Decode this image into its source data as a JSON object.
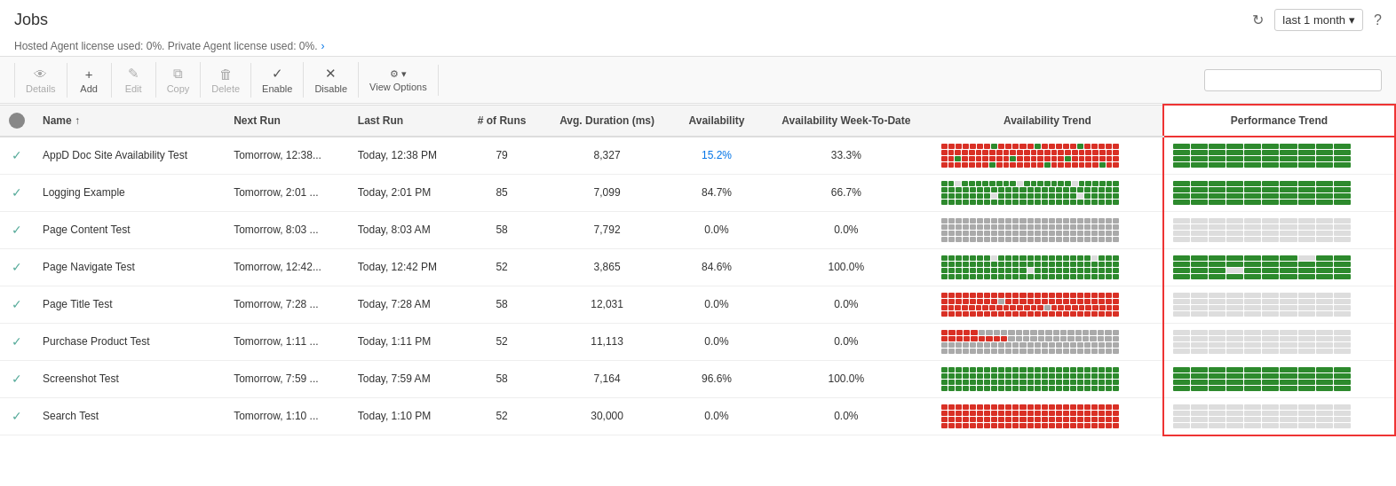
{
  "header": {
    "title": "Jobs",
    "time_filter": "last 1 month",
    "license_text": "Hosted Agent license used: 0%. Private Agent license used: 0%.",
    "license_link": "›"
  },
  "toolbar": {
    "details_label": "Details",
    "add_label": "Add",
    "edit_label": "Edit",
    "copy_label": "Copy",
    "delete_label": "Delete",
    "enable_label": "Enable",
    "disable_label": "Disable",
    "view_options_label": "View Options",
    "search_placeholder": ""
  },
  "columns": [
    {
      "key": "check",
      "label": ""
    },
    {
      "key": "name",
      "label": "Name ↑"
    },
    {
      "key": "next_run",
      "label": "Next Run"
    },
    {
      "key": "last_run",
      "label": "Last Run"
    },
    {
      "key": "runs",
      "label": "# of Runs"
    },
    {
      "key": "avg_duration",
      "label": "Avg. Duration (ms)"
    },
    {
      "key": "availability",
      "label": "Availability"
    },
    {
      "key": "availability_week",
      "label": "Availability Week-To-Date"
    },
    {
      "key": "availability_trend",
      "label": "Availability Trend"
    },
    {
      "key": "performance_trend",
      "label": "Performance Trend"
    }
  ],
  "rows": [
    {
      "name": "AppD Doc Site Availability Test",
      "next_run": "Tomorrow, 12:38...",
      "last_run": "Today, 12:38 PM",
      "runs": "79",
      "avg_duration": "8,327",
      "availability": "15.2%",
      "availability_highlight": true,
      "availability_week": "33.3%",
      "avail_trend": "mixed_bad",
      "perf_trend": "mostly_green"
    },
    {
      "name": "Logging Example",
      "next_run": "Tomorrow, 2:01 ...",
      "last_run": "Today, 2:01 PM",
      "runs": "85",
      "avg_duration": "7,099",
      "availability": "84.7%",
      "availability_highlight": false,
      "availability_week": "66.7%",
      "avail_trend": "mostly_green",
      "perf_trend": "all_green"
    },
    {
      "name": "Page Content Test",
      "next_run": "Tomorrow, 8:03 ...",
      "last_run": "Today, 8:03 AM",
      "runs": "58",
      "avg_duration": "7,792",
      "availability": "0.0%",
      "availability_highlight": false,
      "availability_week": "0.0%",
      "avail_trend": "all_gray",
      "perf_trend": "all_light"
    },
    {
      "name": "Page Navigate Test",
      "next_run": "Tomorrow, 12:42...",
      "last_run": "Today, 12:42 PM",
      "runs": "52",
      "avg_duration": "3,865",
      "availability": "84.6%",
      "availability_highlight": false,
      "availability_week": "100.0%",
      "avail_trend": "mostly_green2",
      "perf_trend": "green_gray"
    },
    {
      "name": "Page Title Test",
      "next_run": "Tomorrow, 7:28 ...",
      "last_run": "Today, 7:28 AM",
      "runs": "58",
      "avg_duration": "12,031",
      "availability": "0.0%",
      "availability_highlight": false,
      "availability_week": "0.0%",
      "avail_trend": "mostly_red",
      "perf_trend": "all_light2"
    },
    {
      "name": "Purchase Product Test",
      "next_run": "Tomorrow, 1:11 ...",
      "last_run": "Today, 1:11 PM",
      "runs": "52",
      "avg_duration": "11,113",
      "availability": "0.0%",
      "availability_highlight": false,
      "availability_week": "0.0%",
      "avail_trend": "red_gray",
      "perf_trend": "all_light3"
    },
    {
      "name": "Screenshot Test",
      "next_run": "Tomorrow, 7:59 ...",
      "last_run": "Today, 7:59 AM",
      "runs": "58",
      "avg_duration": "7,164",
      "availability": "96.6%",
      "availability_highlight": false,
      "availability_week": "100.0%",
      "avail_trend": "all_green2",
      "perf_trend": "all_green2"
    },
    {
      "name": "Search Test",
      "next_run": "Tomorrow, 1:10 ...",
      "last_run": "Today, 1:10 PM",
      "runs": "52",
      "avg_duration": "30,000",
      "availability": "0.0%",
      "availability_highlight": false,
      "availability_week": "0.0%",
      "avail_trend": "mostly_red2",
      "perf_trend": "all_light4"
    }
  ]
}
